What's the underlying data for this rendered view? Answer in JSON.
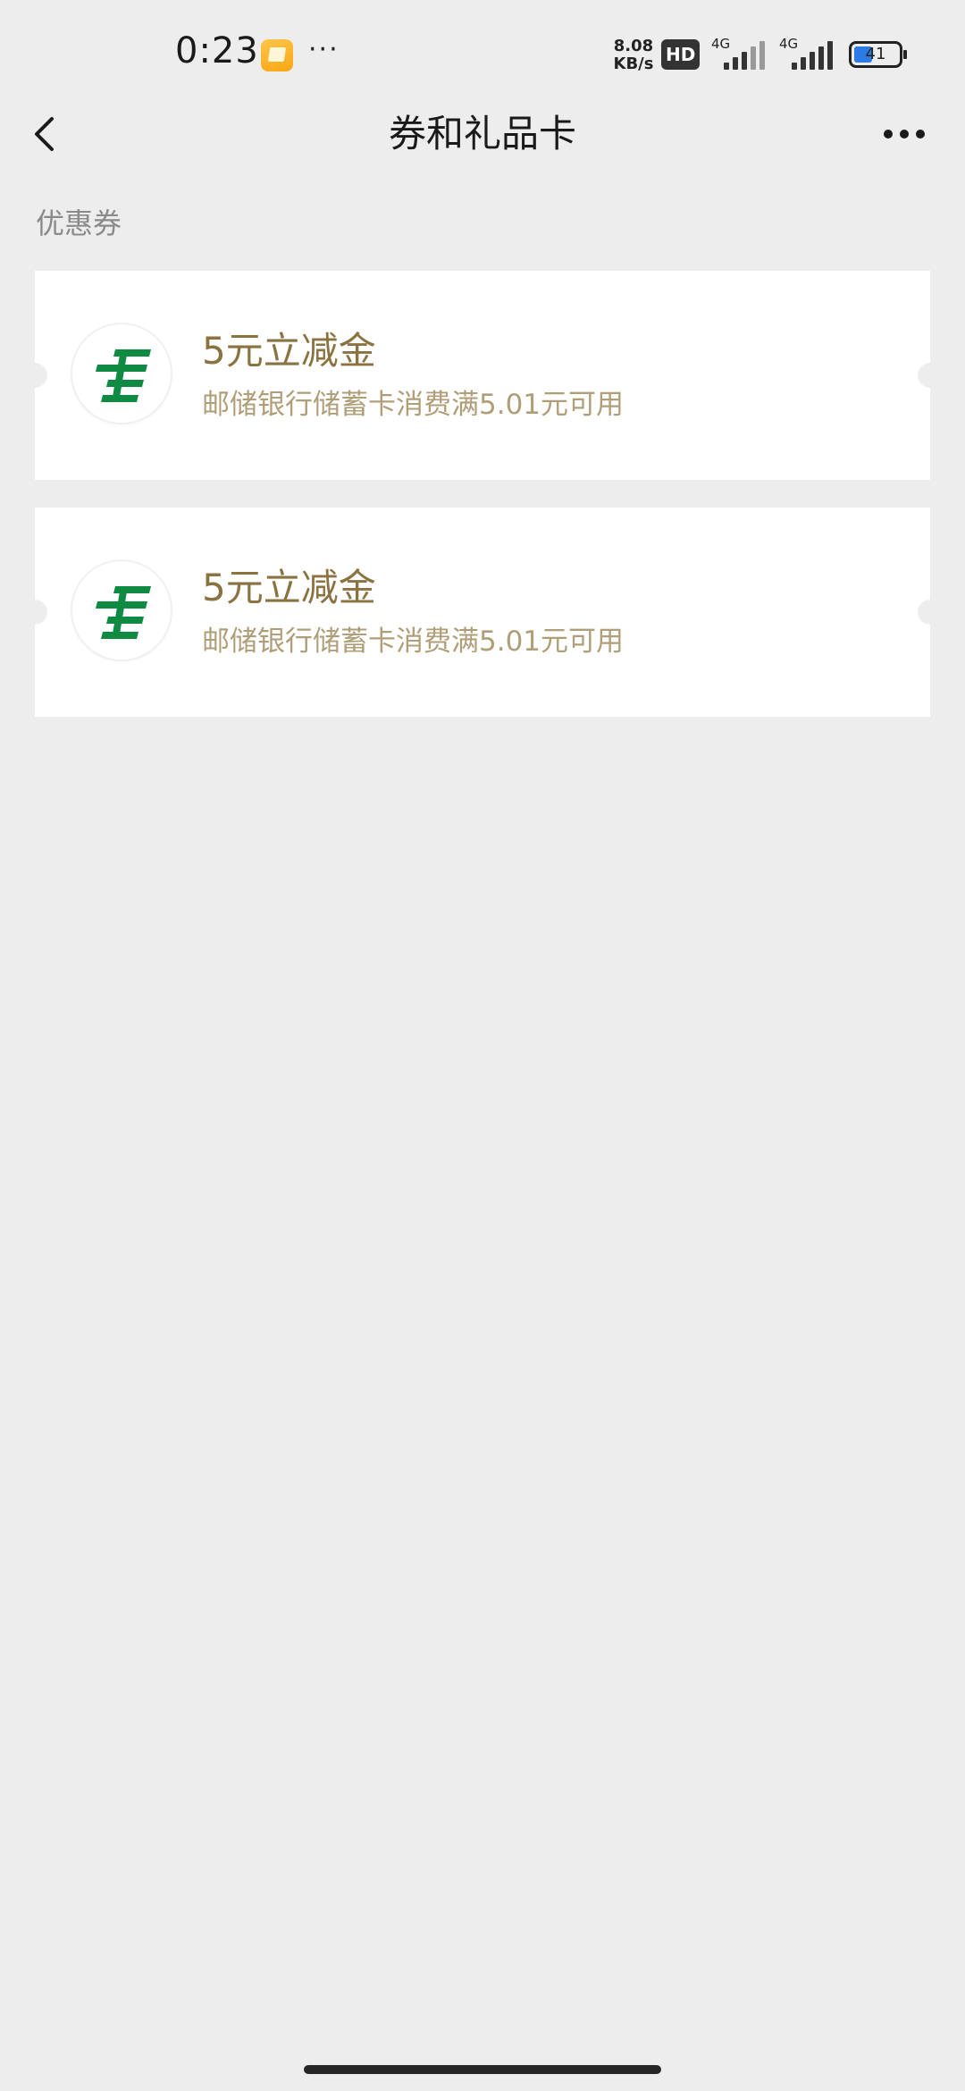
{
  "status_bar": {
    "time": "0:23",
    "more": "···",
    "net_speed_value": "8.08",
    "net_speed_unit": "KB/s",
    "hd_badge": "HD",
    "signal1_label": "4G",
    "signal2_label": "4G",
    "battery_level": "41",
    "battery_fraction": 0.41,
    "battery_color": "#2c7be5"
  },
  "nav": {
    "title": "券和礼品卡",
    "back_icon": "chevron-left-icon",
    "more_icon": "more-dots-icon"
  },
  "section": {
    "label": "优惠券"
  },
  "coupons": [
    {
      "title": "5元立减金",
      "description": "邮储银行储蓄卡消费满5.01元可用",
      "logo": "china-post-bank-logo"
    },
    {
      "title": "5元立减金",
      "description": "邮储银行储蓄卡消费满5.01元可用",
      "logo": "china-post-bank-logo"
    }
  ],
  "colors": {
    "background": "#ededed",
    "card": "#ffffff",
    "coupon_title": "#8a7340",
    "coupon_desc": "#b09e78",
    "logo_green": "#0e8a43",
    "section_label": "#8a8a8a"
  }
}
